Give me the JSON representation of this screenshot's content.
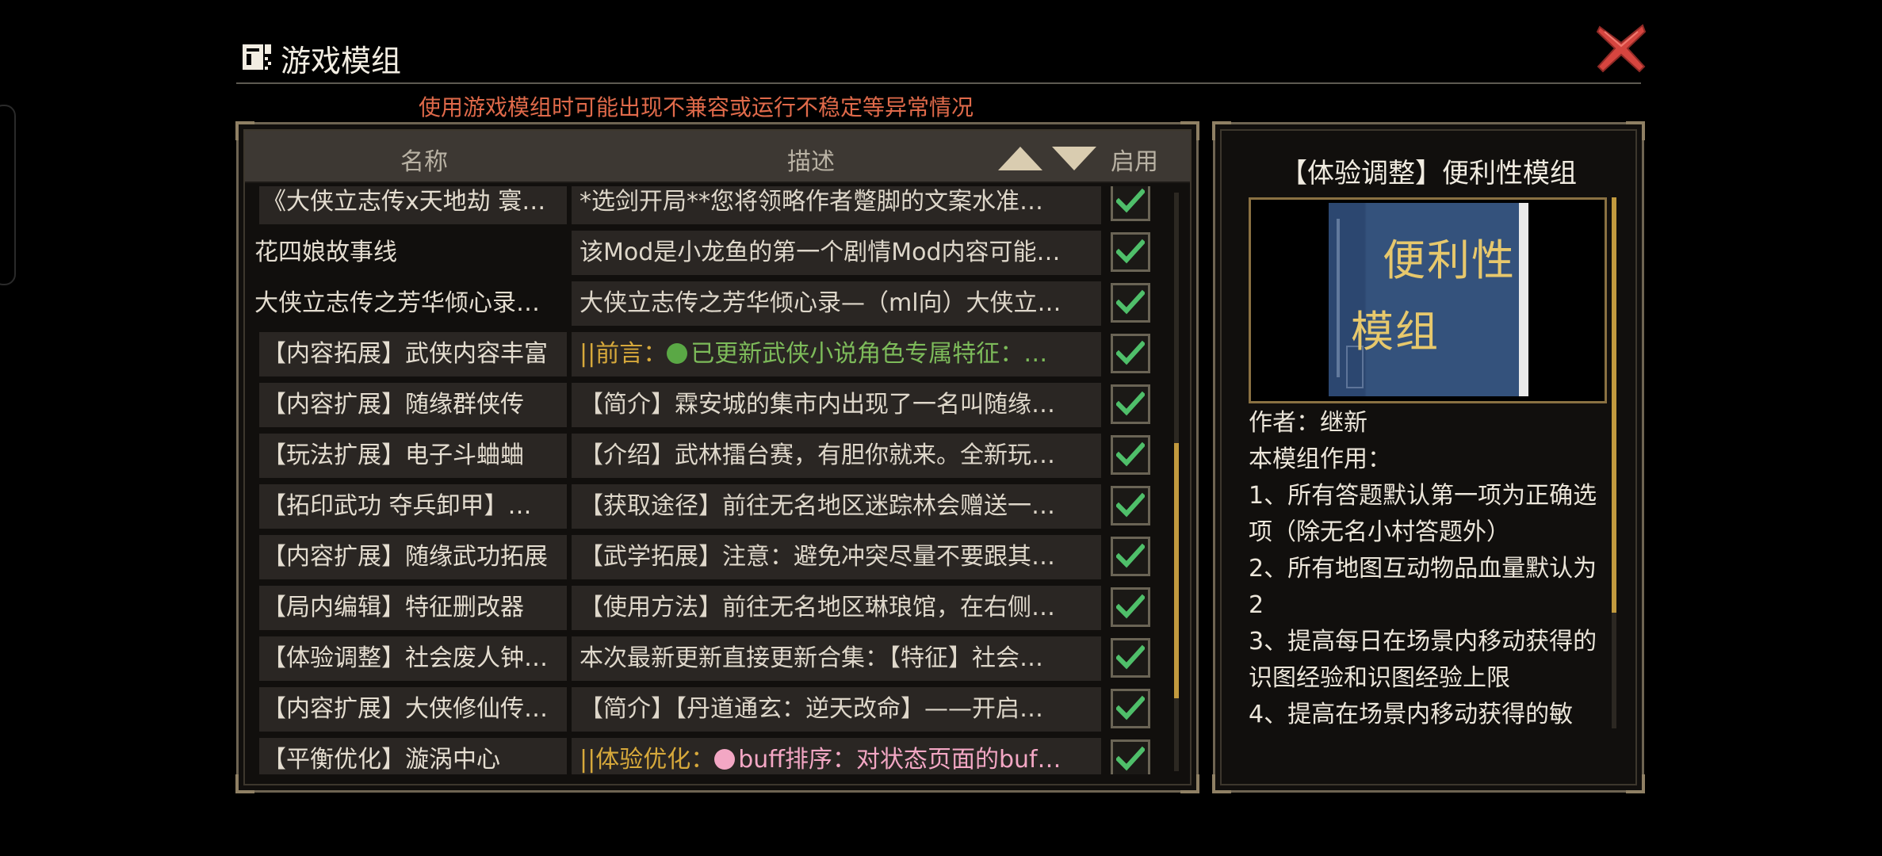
{
  "header": {
    "title": "游戏模组",
    "warning": "使用游戏模组时可能出现不兼容或运行不稳定等异常情况"
  },
  "list": {
    "columns": {
      "name": "名称",
      "description": "描述",
      "enabled": "启用"
    },
    "rows": [
      {
        "name": "《大侠立志传x天地劫 寰…",
        "description": "*选剑开局**您将领略作者蹩脚的文案水准…",
        "enabled": true,
        "name_style": "boxed"
      },
      {
        "name": "花四娘故事线",
        "description": "该Mod是小龙鱼的第一个剧情Mod内容可能…",
        "enabled": true,
        "name_style": "plain"
      },
      {
        "name": "大侠立志传之芳华倾心录…",
        "description": "大侠立志传之芳华倾心录—（ml向）大侠立…",
        "enabled": true,
        "name_style": "plain"
      },
      {
        "name": "【内容拓展】武侠内容丰富",
        "description_parts": [
          {
            "text": "||前言：",
            "style": "gold"
          },
          {
            "text": "已更新武侠小说角色专属特征：…",
            "style": "green",
            "dot": "#5aa845"
          }
        ],
        "enabled": true,
        "name_style": "boxed"
      },
      {
        "name": "【内容扩展】随缘群侠传",
        "description": "【简介】霖安城的集市内出现了一名叫随缘…",
        "enabled": true,
        "name_style": "boxed"
      },
      {
        "name": "【玩法扩展】电子斗蛐蛐",
        "description": "【介绍】武林擂台赛，有胆你就来。全新玩…",
        "enabled": true,
        "name_style": "boxed"
      },
      {
        "name": "【拓印武功 夺兵卸甲】…",
        "description": "【获取途径】前往无名地区迷踪林会赠送一…",
        "enabled": true,
        "name_style": "boxed"
      },
      {
        "name": "【内容扩展】随缘武功拓展",
        "description": "【武学拓展】注意：避免冲突尽量不要跟其…",
        "enabled": true,
        "name_style": "boxed"
      },
      {
        "name": "【局内编辑】特征删改器",
        "description": "【使用方法】前往无名地区琳琅馆，在右侧…",
        "enabled": true,
        "name_style": "boxed"
      },
      {
        "name": "【体验调整】社会废人钟…",
        "description": "本次最新更新直接更新合集：【特征】社会…",
        "enabled": true,
        "name_style": "boxed"
      },
      {
        "name": "【内容扩展】大侠修仙传…",
        "description": "【简介】【丹道通玄：逆天改命】——开启…",
        "enabled": true,
        "name_style": "boxed"
      },
      {
        "name": "【平衡优化】漩涡中心",
        "description_parts": [
          {
            "text": "||体验优化：",
            "style": "gold"
          },
          {
            "text": "buff排序：对状态页面的buf…",
            "style": "pink",
            "dot": "#f3a7c4"
          }
        ],
        "enabled": true,
        "name_style": "boxed"
      }
    ],
    "scroll_position": 0.55
  },
  "detail": {
    "title": "【体验调整】便利性模组",
    "cover_text": [
      "便利性",
      "模组"
    ],
    "author": "作者：继新",
    "lines": [
      "本模组作用：",
      "1、所有答题默认第一项为正确选项（除无名小村答题外）",
      "2、所有地图互动物品血量默认为2",
      "3、提高每日在场景内移动获得的识图经验和识图经验上限",
      "4、提高在场景内移动获得的敏"
    ]
  },
  "colors": {
    "accent_gold": "#c29a3e",
    "warning_red": "#e06a4a",
    "check_green": "#4fbf6a",
    "close_red": "#d6453f"
  },
  "icons": {
    "title": "mod-box-icon",
    "close": "close-x-icon",
    "sort_up": "triangle-up-icon",
    "sort_down": "triangle-down-icon",
    "check": "check-icon"
  }
}
